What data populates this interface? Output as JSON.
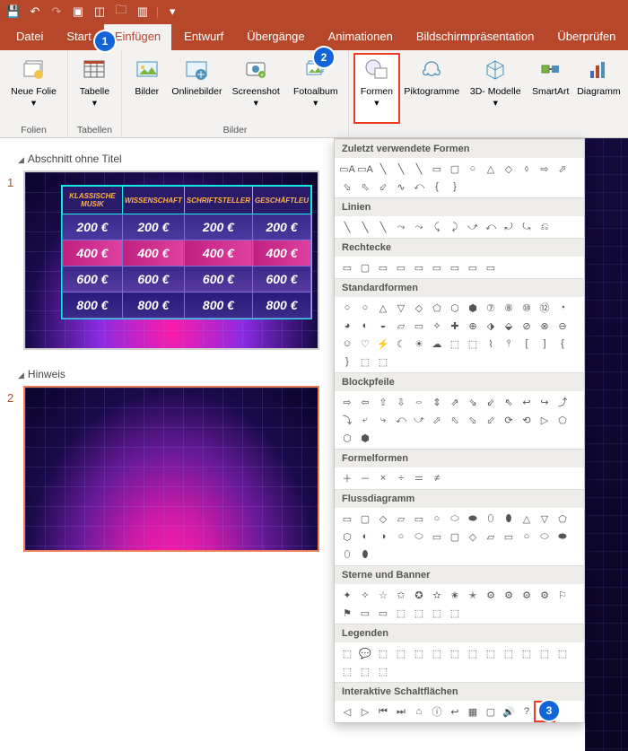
{
  "titlebar": {
    "icons": [
      "save",
      "undo",
      "redo",
      "touch",
      "display",
      "open",
      "grid",
      "more"
    ]
  },
  "tabs": [
    {
      "label": "Datei",
      "active": false
    },
    {
      "label": "Start",
      "active": false
    },
    {
      "label": "Einfügen",
      "active": true
    },
    {
      "label": "Entwurf",
      "active": false
    },
    {
      "label": "Übergänge",
      "active": false
    },
    {
      "label": "Animationen",
      "active": false
    },
    {
      "label": "Bildschirmpräsentation",
      "active": false
    },
    {
      "label": "Überprüfen",
      "active": false
    }
  ],
  "ribbon": {
    "groups": [
      {
        "label": "Folien",
        "items": [
          {
            "label": "Neue\nFolie ▾",
            "icon": "new-slide"
          }
        ]
      },
      {
        "label": "Tabellen",
        "items": [
          {
            "label": "Tabelle\n▾",
            "icon": "table"
          }
        ]
      },
      {
        "label": "Bilder",
        "items": [
          {
            "label": "Bilder",
            "icon": "picture"
          },
          {
            "label": "Onlinebilder",
            "icon": "online-picture"
          },
          {
            "label": "Screenshot\n▾",
            "icon": "screenshot"
          },
          {
            "label": "Fotoalbum\n▾",
            "icon": "album"
          }
        ]
      },
      {
        "label": "",
        "items": [
          {
            "label": "Formen\n▾",
            "icon": "shapes",
            "highlight": true
          },
          {
            "label": "Piktogramme",
            "icon": "icons"
          },
          {
            "label": "3D-\nModelle ▾",
            "icon": "3d"
          },
          {
            "label": "SmartArt",
            "icon": "smartart"
          },
          {
            "label": "Diagramm",
            "icon": "chart"
          }
        ]
      }
    ]
  },
  "sections": [
    {
      "title": "Abschnitt ohne Titel",
      "slide_num": "1"
    },
    {
      "title": "Hinweis",
      "slide_num": "2"
    }
  ],
  "jeopardy": {
    "headers": [
      "KLASSISCHE MUSIK",
      "WISSENSCHAFT",
      "SCHRIFTSTELLER",
      "GESCHÄFTLEU"
    ],
    "rows": [
      [
        "200 €",
        "200 €",
        "200 €",
        "200 €"
      ],
      [
        "400 €",
        "400 €",
        "400 €",
        "400 €"
      ],
      [
        "600 €",
        "600 €",
        "600 €",
        "600 €"
      ],
      [
        "800 €",
        "800 €",
        "800 €",
        "800 €"
      ]
    ]
  },
  "shapes_panel": {
    "sections": [
      {
        "title": "Zuletzt verwendete Formen",
        "count": 20
      },
      {
        "title": "Linien",
        "count": 12
      },
      {
        "title": "Rechtecke",
        "count": 9
      },
      {
        "title": "Standardformen",
        "count": 42
      },
      {
        "title": "Blockpfeile",
        "count": 28
      },
      {
        "title": "Formelformen",
        "count": 6
      },
      {
        "title": "Flussdiagramm",
        "count": 28
      },
      {
        "title": "Sterne und Banner",
        "count": 20
      },
      {
        "title": "Legenden",
        "count": 16
      },
      {
        "title": "Interaktive Schaltflächen",
        "count": 12
      }
    ]
  },
  "callouts": {
    "c1": "1",
    "c2": "2",
    "c3": "3"
  }
}
